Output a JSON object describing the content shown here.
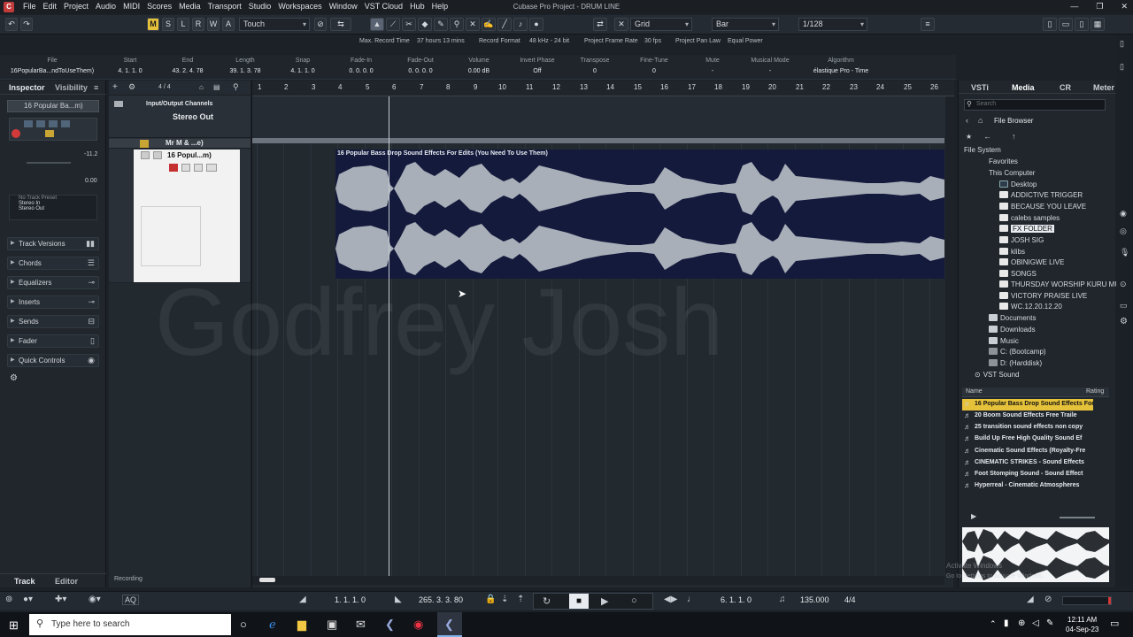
{
  "app": {
    "title": "Cubase Pro Project - DRUM LINE",
    "menu": [
      "File",
      "Edit",
      "Project",
      "Audio",
      "MIDI",
      "Scores",
      "Media",
      "Transport",
      "Studio",
      "Workspaces",
      "Window",
      "VST Cloud",
      "Hub",
      "Help"
    ],
    "window_controls": [
      "—",
      "❐",
      "✕"
    ]
  },
  "toolbar": {
    "mode_buttons": [
      "M",
      "S",
      "L",
      "R",
      "W",
      "A"
    ],
    "automation_mode": "Touch",
    "snap_type": "Grid",
    "grid_type": "Bar",
    "quantize": "1/128"
  },
  "status": [
    {
      "label": "Max. Record Time",
      "value": "37 hours 13 mins"
    },
    {
      "label": "Record Format",
      "value": "48 kHz - 24 bit"
    },
    {
      "label": "Project Frame Rate",
      "value": "30 fps"
    },
    {
      "label": "Project Pan Law",
      "value": "Equal Power"
    }
  ],
  "infoline": {
    "file": {
      "label": "File",
      "value": "16PopularBa...ndToUseThem)"
    },
    "columns": [
      {
        "label": "Start",
        "value": "4. 1. 1.   0"
      },
      {
        "label": "End",
        "value": "43. 2. 4. 78"
      },
      {
        "label": "Length",
        "value": "39. 1. 3. 78"
      },
      {
        "label": "Snap",
        "value": "4. 1. 1.   0"
      },
      {
        "label": "Fade-In",
        "value": "0. 0. 0.   0"
      },
      {
        "label": "Fade-Out",
        "value": "0. 0. 0.   0"
      },
      {
        "label": "Volume",
        "value": "0.00   dB"
      },
      {
        "label": "Invert Phase",
        "value": "Off"
      },
      {
        "label": "Transpose",
        "value": "0"
      },
      {
        "label": "Fine-Tune",
        "value": "0"
      },
      {
        "label": "Mute",
        "value": "-"
      },
      {
        "label": "Musical Mode",
        "value": "-"
      },
      {
        "label": "Algorithm",
        "value": "élastique Pro - Time"
      }
    ]
  },
  "inspector": {
    "tabs": [
      "Inspector",
      "Visibility"
    ],
    "track_name": "16 Popular Ba...m)",
    "volume_value": "-11.2",
    "pan_value": "0.00",
    "preset": "No Track Preset",
    "routing_in": "Stereo In",
    "routing_out": "Stereo Out",
    "sections": [
      "Track Versions",
      "Chords",
      "Equalizers",
      "Inserts",
      "Sends",
      "Fader",
      "Quick Controls"
    ],
    "bottom_tabs": [
      "Track",
      "Editor"
    ]
  },
  "project": {
    "signature": "4 / 4",
    "folder_name": "Input/Output Channels",
    "tracks": [
      {
        "name": "Stereo Out"
      },
      {
        "name": "Mr M & ...e)"
      },
      {
        "name": "16 Popul...m)"
      }
    ],
    "ruler_bars": [
      "1",
      "2",
      "3",
      "4",
      "5",
      "6",
      "7",
      "8",
      "9",
      "10",
      "11",
      "12",
      "13",
      "14",
      "15",
      "16",
      "17",
      "18",
      "19",
      "20",
      "21",
      "22",
      "23",
      "24",
      "25",
      "26"
    ],
    "clip_title": "16 Popular Bass Drop Sound Effects For Edits (You Need To Use Them)",
    "status_text": "Recording",
    "watermark": "Godfrey Josh"
  },
  "right_zone": {
    "tabs": [
      "VSTi",
      "Media",
      "CR",
      "Meter"
    ],
    "search_placeholder": "Search",
    "browser_title": "File Browser",
    "tree": {
      "root": "File System",
      "favorites": "Favorites",
      "this_pc": "This Computer",
      "desktop": "Desktop",
      "folders": [
        "ADDICTIVE TRIGGER",
        "BECAUSE YOU LEAVE",
        "calebs samples",
        "FX FOLDER",
        "JOSH SIG",
        "klibs",
        "OBINIGWE LIVE",
        "SONGS",
        "THURSDAY WORSHIP KURU MU",
        "VICTORY PRAISE LIVE",
        "WC.12.20.12.20"
      ],
      "others": [
        "Documents",
        "Downloads",
        "Music",
        "C: (Bootcamp)",
        "D: (Harddisk)"
      ],
      "vst_sound": "VST Sound"
    },
    "results_headers": [
      "Name",
      "Rating"
    ],
    "results": [
      "16 Popular Bass Drop Sound Effects For",
      "20 Boom Sound Effects Free  Traile",
      "25 transition sound effects non copy",
      "Build Up Free High Quality Sound Ef",
      "Cinematic Sound Effects (Royalty-Fre",
      "CINEMATIC STRIKES - Sound Effects",
      "Foot Stomping Sound - Sound Effect",
      "Hyperreal - Cinematic Atmospheres"
    ],
    "activate": "Activate Windows",
    "activate_sub": "Go to Settings to activate Windows."
  },
  "transport": {
    "left_locator": "1. 1. 1.   0",
    "right_locator": "265. 3. 3. 80",
    "position": "6. 1. 1.   0",
    "tempo": "135.000",
    "signature": "4/4"
  },
  "taskbar": {
    "search_placeholder": "Type here to search",
    "time": "12:11 AM",
    "date": "04-Sep-23"
  },
  "colors": {
    "accent": "#e6c23b",
    "record": "#d23a3a",
    "clip_bg": "#141a3c",
    "waveform": "#a9afb8"
  }
}
